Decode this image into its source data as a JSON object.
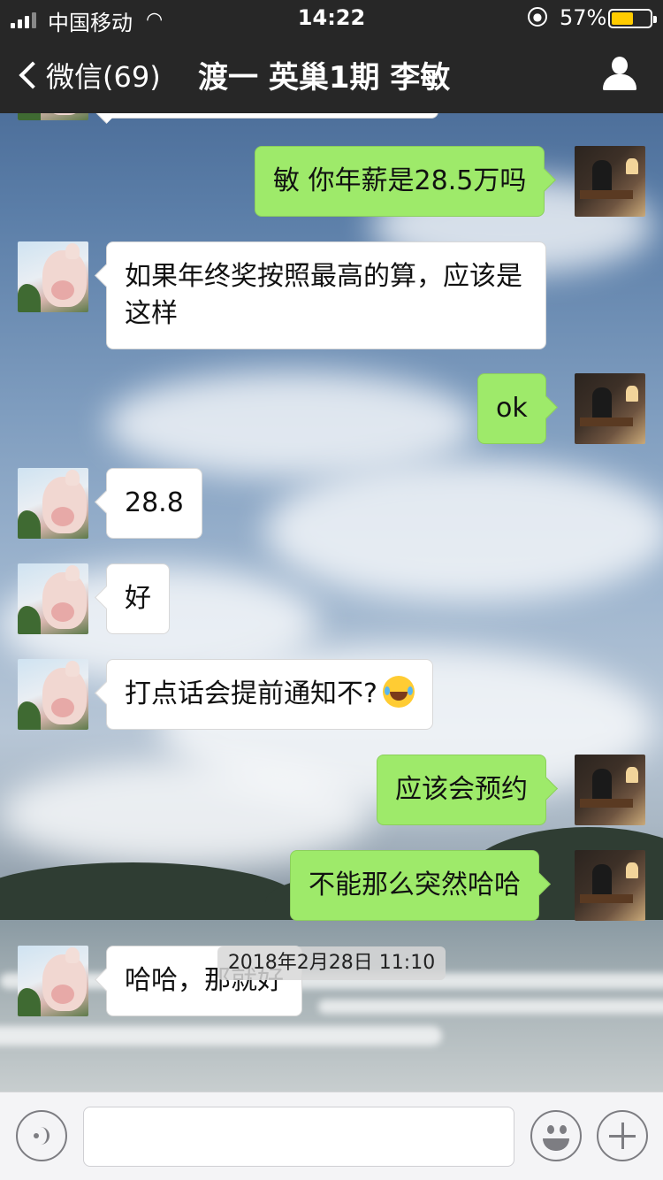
{
  "status_bar": {
    "carrier": "中国移动",
    "time": "14:22",
    "battery_percent": "57%",
    "battery_level": 0.57,
    "icons": [
      "signal-icon",
      "wifi-icon",
      "orientation-lock-icon",
      "battery-icon"
    ]
  },
  "nav": {
    "back_label": "微信(69)",
    "title": "渡一 英巢1期 李敏",
    "right_icon": "person-icon"
  },
  "messages": [
    {
      "side": "right",
      "text": "敏 你年薪是28.5万吗"
    },
    {
      "side": "left",
      "text": "如果年终奖按照最高的算，应该是这样"
    },
    {
      "side": "right",
      "text": "ok"
    },
    {
      "side": "left",
      "text": "28.8"
    },
    {
      "side": "left",
      "text": "好"
    },
    {
      "side": "left",
      "text": "打点话会提前通知不?",
      "emoji": "tears-of-joy-emoji"
    },
    {
      "side": "right",
      "text": "应该会预约"
    },
    {
      "side": "right",
      "text": "不能那么突然哈哈"
    },
    {
      "side": "left",
      "text": "哈哈，那就好"
    }
  ],
  "timestamp": "2018年2月28日 11:10",
  "input_bar": {
    "icons": [
      "voice-icon",
      "emoji-icon",
      "plus-icon"
    ],
    "value": ""
  },
  "colors": {
    "nav_background": "#272727",
    "sent_bubble": "#9eea6a",
    "received_bubble": "#ffffff",
    "battery_fill": "#ffcc00"
  }
}
